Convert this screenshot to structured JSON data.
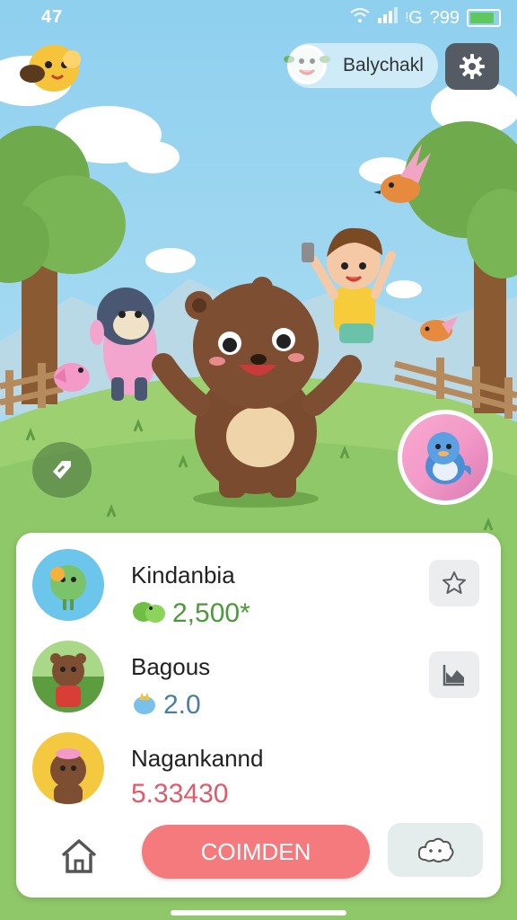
{
  "status_bar": {
    "time": "47",
    "network": "ᵎG",
    "battery_text": "?99"
  },
  "profile": {
    "name": "Balychakl"
  },
  "friends": [
    {
      "name": "Kindanbia",
      "value": "2,500*",
      "value_color": "#4b9a3a",
      "action_icon": "star-icon"
    },
    {
      "name": "Bagous",
      "value": "2.0",
      "value_color": "#4a7ca6",
      "action_icon": "chart-icon"
    },
    {
      "name": "Nagankannd",
      "value": "5.33430",
      "value_color": "#e05a6a",
      "action_icon": ""
    }
  ],
  "bottom_bar": {
    "confirm_label": "COIMDEN"
  },
  "colors": {
    "accent": "#f47a7e",
    "sky": "#9ed4ee",
    "grass": "#8fc868"
  }
}
